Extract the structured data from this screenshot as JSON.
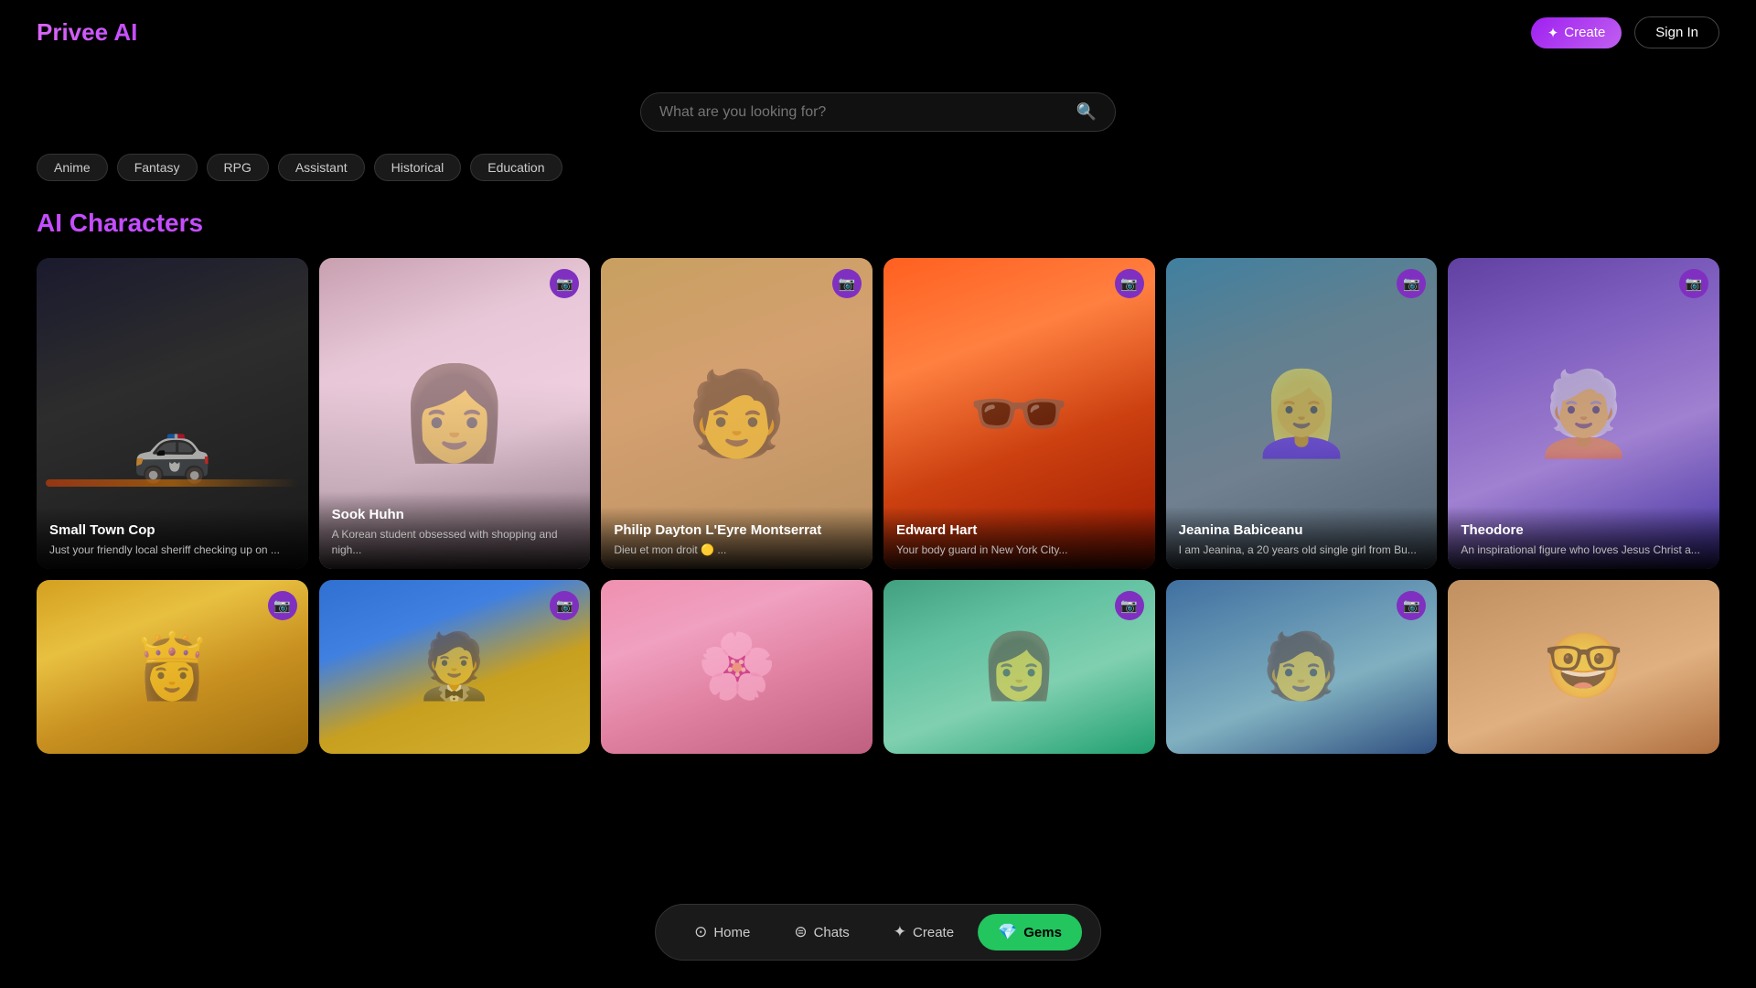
{
  "app": {
    "title": "Privee AI"
  },
  "header": {
    "logo": "Privee AI",
    "create_label": "Create",
    "signin_label": "Sign In"
  },
  "search": {
    "placeholder": "What are you looking for?"
  },
  "filter_tags": [
    {
      "id": "anime",
      "label": "Anime"
    },
    {
      "id": "fantasy",
      "label": "Fantasy"
    },
    {
      "id": "rpg",
      "label": "RPG"
    },
    {
      "id": "assistant",
      "label": "Assistant"
    },
    {
      "id": "historical",
      "label": "Historical"
    },
    {
      "id": "education",
      "label": "Education"
    }
  ],
  "characters_section": {
    "title": "AI Characters"
  },
  "characters": [
    {
      "id": "small-town-cop",
      "name": "Small Town Cop",
      "desc": "Just your friendly local sheriff checking up on ...",
      "has_camera": false,
      "theme": "card-cop"
    },
    {
      "id": "sook-huhn",
      "name": "Sook Huhn",
      "desc": "A Korean student obsessed with shopping and nigh...",
      "has_camera": true,
      "theme": "card-korean"
    },
    {
      "id": "philip-dayton",
      "name": "Philip Dayton L'Eyre Montserrat",
      "desc": "Dieu et mon droit 🟡 ...",
      "has_camera": true,
      "theme": "card-anime"
    },
    {
      "id": "edward-hart",
      "name": "Edward Hart",
      "desc": "Your body guard in New York City...",
      "has_camera": true,
      "theme": "card-edward"
    },
    {
      "id": "jeanina-babiceanu",
      "name": "Jeanina Babiceanu",
      "desc": "I am Jeanina, a 20 years old single girl from Bu...",
      "has_camera": true,
      "theme": "card-jeanina"
    },
    {
      "id": "theodore",
      "name": "Theodore",
      "desc": "An inspirational figure who loves Jesus Christ a...",
      "has_camera": true,
      "theme": "card-theodore"
    },
    {
      "id": "palace-lady",
      "name": "",
      "desc": "",
      "has_camera": true,
      "theme": "card-palace",
      "row": 2
    },
    {
      "id": "suit-man",
      "name": "",
      "desc": "",
      "has_camera": true,
      "theme": "card-suit",
      "row": 2
    },
    {
      "id": "sakura-girl",
      "name": "",
      "desc": "",
      "has_camera": false,
      "theme": "card-sakura",
      "row": 2
    },
    {
      "id": "asian-girl",
      "name": "",
      "desc": "",
      "has_camera": true,
      "theme": "card-asian-girl",
      "row": 2
    },
    {
      "id": "man-field",
      "name": "",
      "desc": "",
      "has_camera": true,
      "theme": "card-man-field",
      "row": 2
    },
    {
      "id": "glasses-man",
      "name": "",
      "desc": "",
      "has_camera": false,
      "theme": "card-glasses",
      "row": 2
    }
  ],
  "bottom_nav": {
    "items": [
      {
        "id": "home",
        "label": "Home",
        "icon": "⊙",
        "active": false
      },
      {
        "id": "chats",
        "label": "Chats",
        "icon": "⊜",
        "active": false
      },
      {
        "id": "create",
        "label": "Create",
        "icon": "✦",
        "active": false
      },
      {
        "id": "gems",
        "label": "Gems",
        "icon": "💎",
        "active": true
      }
    ]
  },
  "icons": {
    "camera": "📷",
    "search": "🔍",
    "sparkle": "✦"
  }
}
